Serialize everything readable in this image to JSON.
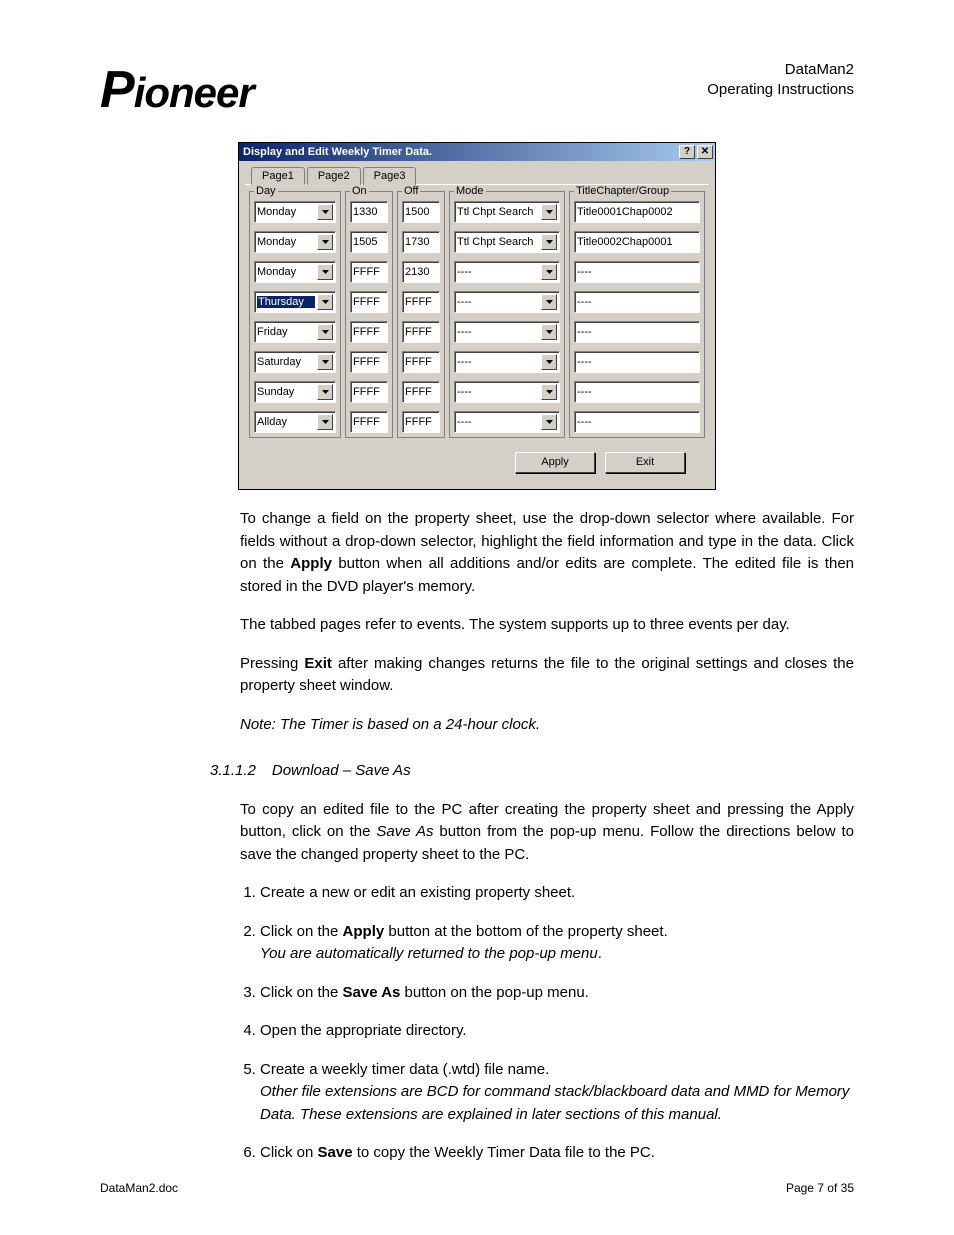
{
  "header": {
    "logo_text": "Pioneer",
    "doc_title_line1": "DataMan2",
    "doc_title_line2": "Operating Instructions"
  },
  "dialog": {
    "title": "Display and Edit Weekly Timer Data.",
    "help_glyph": "?",
    "close_glyph": "✕",
    "tabs": [
      "Page1",
      "Page2",
      "Page3"
    ],
    "active_tab": 0,
    "col_headers": {
      "day": "Day",
      "on": "On",
      "off": "Off",
      "mode": "Mode",
      "tcg": "TitleChapter/Group"
    },
    "rows": [
      {
        "day": "Monday",
        "on": "1330",
        "off": "1500",
        "mode": "Ttl Chpt Search",
        "tcg": "Title0001Chap0002",
        "sel": false
      },
      {
        "day": "Monday",
        "on": "1505",
        "off": "1730",
        "mode": "Ttl Chpt Search",
        "tcg": "Title0002Chap0001",
        "sel": false
      },
      {
        "day": "Monday",
        "on": "FFFF",
        "off": "2130",
        "mode": "----",
        "tcg": "----",
        "sel": false
      },
      {
        "day": "Thursday",
        "on": "FFFF",
        "off": "FFFF",
        "mode": "----",
        "tcg": "----",
        "sel": true
      },
      {
        "day": "Friday",
        "on": "FFFF",
        "off": "FFFF",
        "mode": "----",
        "tcg": "----",
        "sel": false
      },
      {
        "day": "Saturday",
        "on": "FFFF",
        "off": "FFFF",
        "mode": "----",
        "tcg": "----",
        "sel": false
      },
      {
        "day": "Sunday",
        "on": "FFFF",
        "off": "FFFF",
        "mode": "----",
        "tcg": "----",
        "sel": false
      },
      {
        "day": "Allday",
        "on": "FFFF",
        "off": "FFFF",
        "mode": "----",
        "tcg": "----",
        "sel": false
      }
    ],
    "buttons": {
      "apply": "Apply",
      "exit": "Exit"
    }
  },
  "body": {
    "p1_a": "To change a field on the property sheet, use the drop-down selector where available. For fields without a drop-down selector, highlight the field information and type in the data.  Click on the ",
    "p1_b": "Apply",
    "p1_c": " button when all additions and/or edits are complete.  The edited file is then stored in the DVD player's memory.",
    "p2": "The tabbed pages refer to events.  The system supports up to three events per day.",
    "p3_a": "Pressing ",
    "p3_b": "Exit",
    "p3_c": " after making changes returns the file to the original settings and closes the property sheet window.",
    "note": "Note: The Timer is based on a 24-hour clock.",
    "section_num": "3.1.1.2",
    "section_title": "Download – Save As",
    "p4_a": "To copy an edited file to the PC after creating the property sheet and pressing the Apply button, click on the ",
    "p4_b": "Save As",
    "p4_c": " button from the pop-up menu.  Follow the directions below to save the changed property sheet to the PC.",
    "steps": {
      "s1": "Create a new or edit an existing property sheet.",
      "s2a": "Click on the ",
      "s2b": "Apply",
      "s2c": " button at the bottom of the property sheet.",
      "s2_em": "You are automatically returned to the pop-up menu",
      "s2_dot": ".",
      "s3a": "Click on the ",
      "s3b": "Save As",
      "s3c": " button on the pop-up menu.",
      "s4": "Open the appropriate directory.",
      "s5": "Create a weekly timer data (.wtd) file name.",
      "s5_em": "Other file extensions are BCD for command stack/blackboard data and MMD for Memory Data.  These extensions are explained in later sections of this manual.",
      "s6a": "Click on ",
      "s6b": "Save",
      "s6c": " to copy the Weekly Timer Data file to the PC."
    }
  },
  "footer": {
    "left": "DataMan2.doc",
    "right": "Page 7 of 35"
  }
}
